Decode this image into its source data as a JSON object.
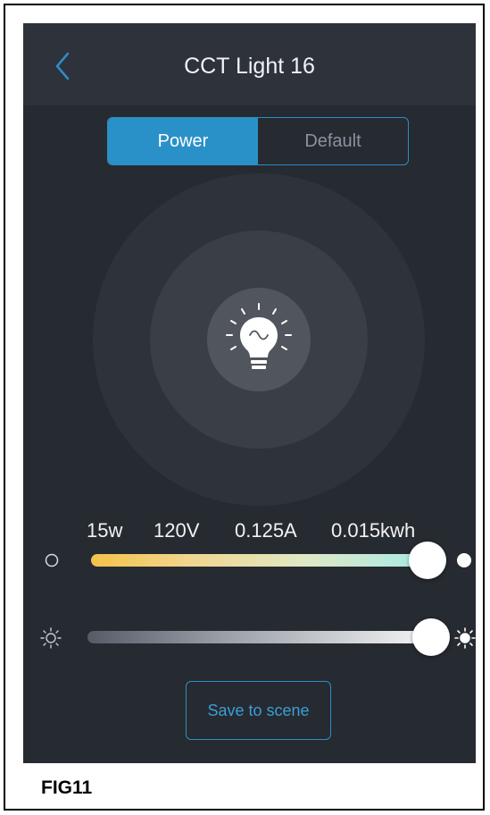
{
  "header": {
    "title": "CCT Light 16",
    "back_icon": "chevron-left-icon"
  },
  "tabs": [
    {
      "label": "Power",
      "active": true
    },
    {
      "label": "Default",
      "active": false
    }
  ],
  "bulb": {
    "icon": "light-bulb-icon"
  },
  "readout": {
    "power": "15w",
    "voltage": "120V",
    "current": "0.125A",
    "energy": "0.015kwh"
  },
  "cct_slider": {
    "icon_low": "circle-outline-icon",
    "icon_high": "circle-filled-icon",
    "value": 0.95
  },
  "brightness_slider": {
    "icon_low": "sun-outline-icon",
    "icon_high": "sun-filled-icon",
    "value": 0.98
  },
  "save_button": {
    "label": "Save to scene"
  },
  "caption": "FIG11",
  "colors": {
    "accent": "#2a91c8",
    "background": "#262a31",
    "header": "#2d323b"
  }
}
